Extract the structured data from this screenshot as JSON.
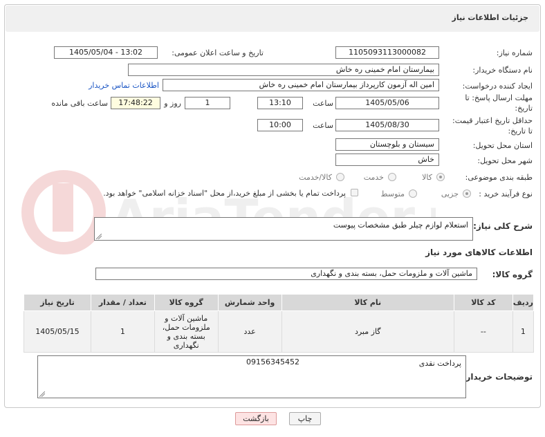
{
  "header": {
    "title": "جزئیات اطلاعات نیاز"
  },
  "form": {
    "need_number_label": "شماره نیاز:",
    "need_number": "1105093113000082",
    "announce_label": "تاریخ و ساعت اعلان عمومی:",
    "announce_value": "1405/05/04 - 13:02",
    "buyer_org_label": "نام دستگاه خریدار:",
    "buyer_org": "بیمارستان امام خمینی  ره  خاش",
    "requester_label": "ایجاد کننده درخواست:",
    "requester": "امین اله آزمون کارپرداز بیمارستان امام خمینی  ره  خاش",
    "buyer_contact_link": "اطلاعات تماس خریدار",
    "reply_deadline_label_1": "مهلت ارسال پاسخ: تا",
    "reply_deadline_label_2": "تاریخ:",
    "reply_date": "1405/05/06",
    "time_label": "ساعت",
    "reply_time": "13:10",
    "days_value": "1",
    "days_label": "روز و",
    "remaining_time": "17:48:22",
    "remaining_label": "ساعت باقی مانده",
    "price_validity_label_1": "حداقل تاریخ اعتبار قیمت:",
    "price_validity_label_2": "تا تاریخ:",
    "price_date": "1405/08/30",
    "price_time": "10:00",
    "province_label": "استان محل تحویل:",
    "province": "سیستان و بلوچستان",
    "city_label": "شهر محل تحویل:",
    "city": "خاش",
    "category_label": "طبقه بندی موضوعی:",
    "category_options": [
      "کالا",
      "خدمت",
      "کالا/خدمت"
    ],
    "category_selected": "کالا",
    "purchase_type_label": "نوع فرآیند خرید :",
    "purchase_options": [
      "جزیی",
      "متوسط"
    ],
    "purchase_selected": "جزیی",
    "payment_note": "پرداخت تمام یا بخشی از مبلغ خرید،از محل \"اسناد خزانه اسلامی\" خواهد بود."
  },
  "description": {
    "label": "شرح کلی نیاز:",
    "text": "استعلام  لوازم چیلر طبق مشخصات پیوست"
  },
  "goods": {
    "section_title": "اطلاعات کالاهای مورد نیاز",
    "group_label": "گروه کالا:",
    "group_value": "ماشین آلات و ملزومات حمل، بسته بندی و نگهداری"
  },
  "table": {
    "headers": [
      "ردیف",
      "کد کالا",
      "نام کالا",
      "واحد شمارش",
      "گروه کالا",
      "تعداد / مقدار",
      "تاریخ نیاز"
    ],
    "rows": [
      [
        "1",
        "--",
        "گاز مبرد",
        "عدد",
        "ماشین آلات و ملزومات حمل، بسته بندی و نگهداری",
        "1",
        "1405/05/15"
      ]
    ]
  },
  "buyer_notes": {
    "label": "توضیحات خریدار:",
    "text": "پرداخت نقدی",
    "phone": "09156345452"
  },
  "buttons": {
    "print": "چاپ",
    "back": "بازگشت"
  },
  "watermark_text": "AriaTender.net"
}
